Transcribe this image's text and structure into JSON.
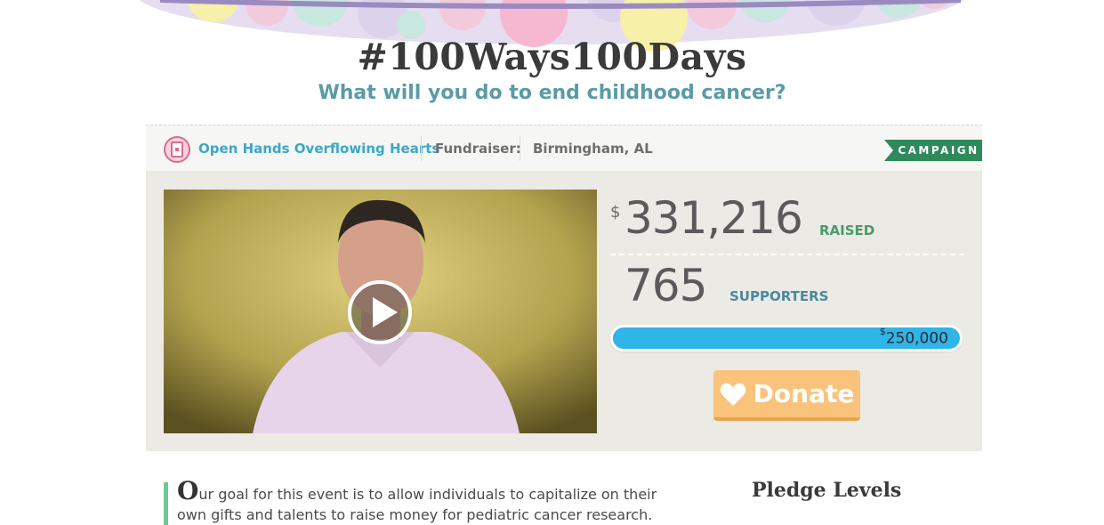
{
  "header": {
    "title": "#100Ways100Days",
    "subtitle": "What will you do to end childhood cancer?"
  },
  "infobar": {
    "org_name": "Open Hands Overflowing Hearts",
    "fundraiser_label": "Fundraiser:",
    "location": "Birmingham, AL",
    "badge": "CAMPAIGN"
  },
  "stats": {
    "currency": "$",
    "raised": "331,216",
    "raised_label": "RAISED",
    "supporters": "765",
    "supporters_label": "SUPPORTERS",
    "goal_currency": "$",
    "goal": "250,000",
    "progress_fraction": 1.0
  },
  "donate": {
    "label": "Donate"
  },
  "body": {
    "drop_cap": "O",
    "text": "ur goal for this event is to allow individuals to capitalize on their own gifts and talents to raise money for pediatric cancer research. We want"
  },
  "sidebar": {
    "pledge_title": "Pledge Levels"
  },
  "colors": {
    "accent_blue": "#2fb5e8",
    "campaign_green": "#2e8a5a",
    "donate_orange": "#f9c37c",
    "subtitle_teal": "#5a9ba7"
  },
  "icons": {
    "play": "play-icon",
    "heart": "heart-icon",
    "org_logo": "org-logo-icon"
  }
}
